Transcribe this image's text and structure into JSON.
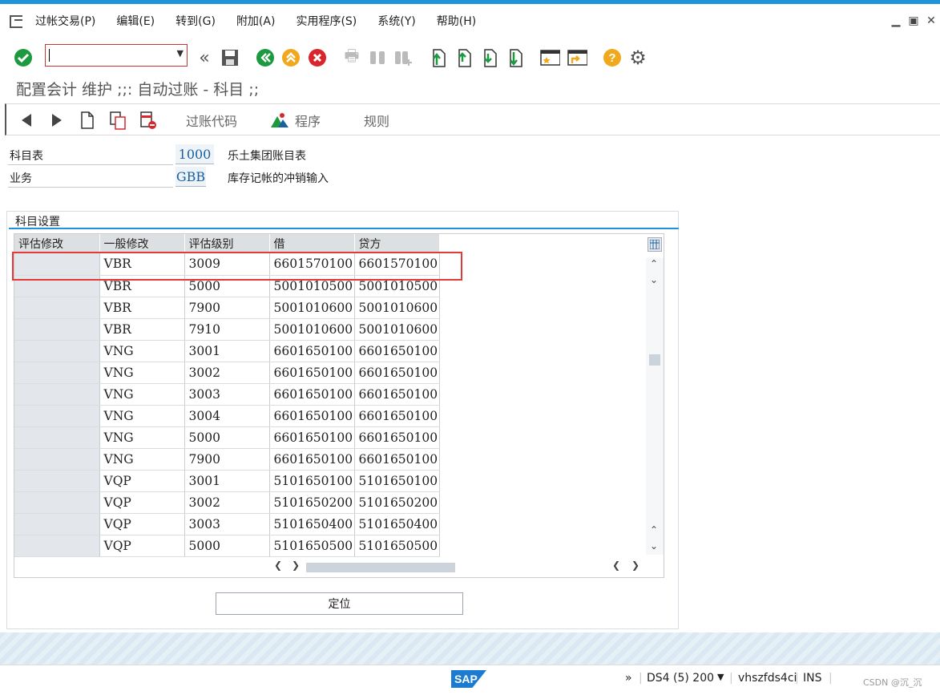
{
  "menu": [
    "过帐交易(P)",
    "编辑(E)",
    "转到(G)",
    "附加(A)",
    "实用程序(S)",
    "系统(Y)",
    "帮助(H)"
  ],
  "title": "配置会计 维护 ;;: 自动过账 - 科目 ;;",
  "app_toolbar": {
    "posting_code": "过账代码",
    "program": "程序",
    "rules": "规则"
  },
  "header": {
    "coa_label": "科目表",
    "coa_value": "1000",
    "coa_desc": "乐土集团账目表",
    "txn_label": "业务",
    "txn_value": "GBB",
    "txn_desc": "库存记帐的冲销输入"
  },
  "group_title": "科目设置",
  "table": {
    "columns": [
      "评估修改",
      "一般修改",
      "评估级别",
      "借",
      "贷方"
    ],
    "rows": [
      [
        "",
        "VBR",
        "3009",
        "6601570100",
        "6601570100"
      ],
      [
        "",
        "VBR",
        "5000",
        "5001010500",
        "5001010500"
      ],
      [
        "",
        "VBR",
        "7900",
        "5001010600",
        "5001010600"
      ],
      [
        "",
        "VBR",
        "7910",
        "5001010600",
        "5001010600"
      ],
      [
        "",
        "VNG",
        "3001",
        "6601650100",
        "6601650100"
      ],
      [
        "",
        "VNG",
        "3002",
        "6601650100",
        "6601650100"
      ],
      [
        "",
        "VNG",
        "3003",
        "6601650100",
        "6601650100"
      ],
      [
        "",
        "VNG",
        "3004",
        "6601650100",
        "6601650100"
      ],
      [
        "",
        "VNG",
        "5000",
        "6601650100",
        "6601650100"
      ],
      [
        "",
        "VNG",
        "7900",
        "6601650100",
        "6601650100"
      ],
      [
        "",
        "VQP",
        "3001",
        "5101650100",
        "5101650100"
      ],
      [
        "",
        "VQP",
        "3002",
        "5101650200",
        "5101650200"
      ],
      [
        "",
        "VQP",
        "3003",
        "5101650400",
        "5101650400"
      ],
      [
        "",
        "VQP",
        "5000",
        "5101650500",
        "5101650500"
      ]
    ]
  },
  "locate_button": "定位",
  "status": {
    "logo": "SAP",
    "system": "DS4 (5) 200",
    "server": "vhszfds4ci",
    "mode": "INS",
    "watermark": "CSDN @沉_沉"
  }
}
